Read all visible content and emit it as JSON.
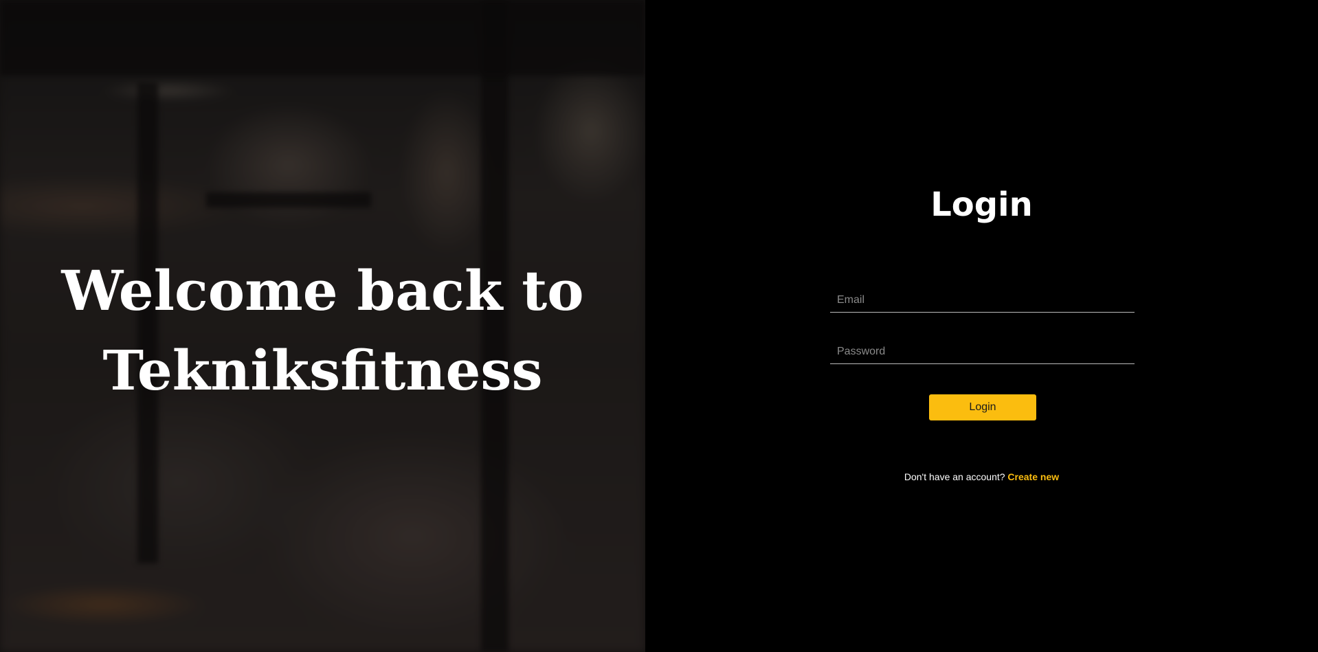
{
  "hero": {
    "title_line1": "Welcome back to",
    "title_line2": "Tekniksfitness",
    "background": "gym-interior-photo"
  },
  "login": {
    "heading": "Login",
    "email": {
      "placeholder": "Email",
      "value": ""
    },
    "password": {
      "placeholder": "Password",
      "value": ""
    },
    "submit_label": "Login",
    "signup_prompt": "Don't have an account?",
    "signup_link": "Create new"
  },
  "colors": {
    "accent": "#fbbd0f",
    "panel_background": "#000000",
    "text": "#ffffff"
  }
}
